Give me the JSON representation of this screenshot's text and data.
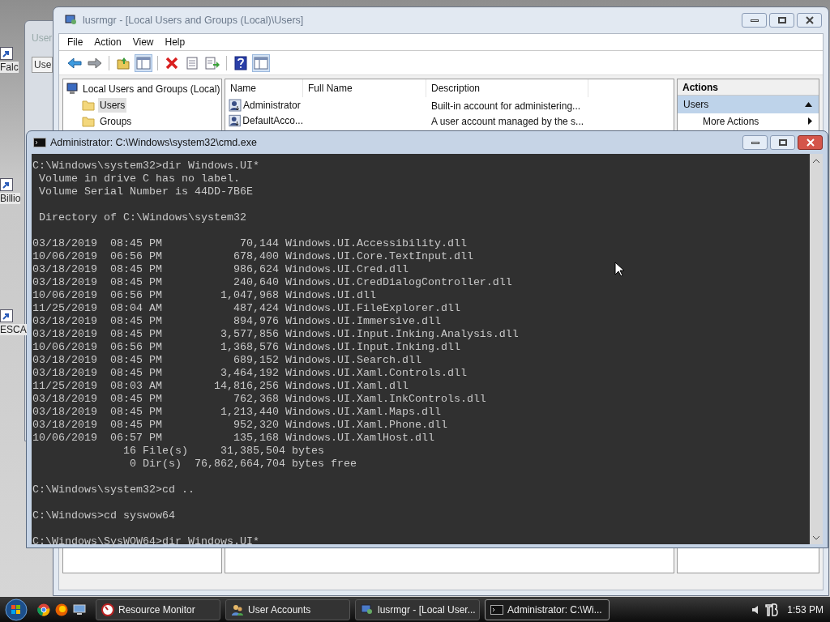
{
  "desktop_icons": [
    {
      "label": "Falc"
    },
    {
      "label": "Billio"
    },
    {
      "label": "ESCA"
    }
  ],
  "background_window": {
    "title": "User",
    "tab": "Use"
  },
  "mmc": {
    "title": "lusrmgr - [Local Users and Groups (Local)\\Users]",
    "menu": [
      "File",
      "Action",
      "View",
      "Help"
    ],
    "toolbar": [
      {
        "kind": "back",
        "pressed": false
      },
      {
        "kind": "forward",
        "pressed": false
      },
      {
        "kind": "up",
        "pressed": false
      },
      {
        "kind": "tree",
        "pressed": true
      },
      {
        "kind": "delete",
        "pressed": false
      },
      {
        "kind": "properties",
        "pressed": false
      },
      {
        "kind": "export",
        "pressed": false
      },
      {
        "kind": "help",
        "pressed": false
      },
      {
        "kind": "actionpane",
        "pressed": true
      }
    ],
    "tree": {
      "root": "Local Users and Groups (Local)",
      "children": [
        {
          "label": "Users",
          "selected": true
        },
        {
          "label": "Groups",
          "selected": false
        }
      ]
    },
    "columns": [
      "Name",
      "Full Name",
      "Description"
    ],
    "rows": [
      {
        "name": "Administrator",
        "description": "Built-in account for administering..."
      },
      {
        "name": "DefaultAcco...",
        "description": "A user account managed by the s..."
      }
    ],
    "actions": {
      "header": "Actions",
      "sections": [
        {
          "title": "Users",
          "selected": true,
          "items": [
            "More Actions"
          ]
        }
      ]
    }
  },
  "console": {
    "title": "Administrator: C:\\Windows\\system32\\cmd.exe",
    "lines": [
      {
        "kind": "text",
        "text": "C:\\Windows\\system32>dir Windows.UI*"
      },
      {
        "kind": "text",
        "text": " Volume in drive C has no label."
      },
      {
        "kind": "text",
        "text": " Volume Serial Number is 44DD-7B6E"
      },
      {
        "kind": "blank"
      },
      {
        "kind": "text",
        "text": " Directory of C:\\Windows\\system32"
      },
      {
        "kind": "blank"
      },
      {
        "kind": "text",
        "text": "03/18/2019  08:45 PM            70,144 Windows.UI.Accessibility.dll"
      },
      {
        "kind": "text",
        "text": "10/06/2019  06:56 PM           678,400 Windows.UI.Core.TextInput.dll"
      },
      {
        "kind": "text",
        "text": "03/18/2019  08:45 PM           986,624 Windows.UI.Cred.dll"
      },
      {
        "kind": "text",
        "text": "03/18/2019  08:45 PM           240,640 Windows.UI.CredDialogController.dll"
      },
      {
        "kind": "text",
        "text": "10/06/2019  06:56 PM         1,047,968 Windows.UI.dll"
      },
      {
        "kind": "text",
        "text": "11/25/2019  08:04 AM           487,424 Windows.UI.FileExplorer.dll"
      },
      {
        "kind": "text",
        "text": "03/18/2019  08:45 PM           894,976 Windows.UI.Immersive.dll"
      },
      {
        "kind": "text",
        "text": "03/18/2019  08:45 PM         3,577,856 Windows.UI.Input.Inking.Analysis.dll"
      },
      {
        "kind": "text",
        "text": "10/06/2019  06:56 PM         1,368,576 Windows.UI.Input.Inking.dll"
      },
      {
        "kind": "text",
        "text": "03/18/2019  08:45 PM           689,152 Windows.UI.Search.dll"
      },
      {
        "kind": "text",
        "text": "03/18/2019  08:45 PM         3,464,192 Windows.UI.Xaml.Controls.dll"
      },
      {
        "kind": "text",
        "text": "11/25/2019  08:03 AM        14,816,256 Windows.UI.Xaml.dll"
      },
      {
        "kind": "text",
        "text": "03/18/2019  08:45 PM           762,368 Windows.UI.Xaml.InkControls.dll"
      },
      {
        "kind": "text",
        "text": "03/18/2019  08:45 PM         1,213,440 Windows.UI.Xaml.Maps.dll"
      },
      {
        "kind": "text",
        "text": "03/18/2019  08:45 PM           952,320 Windows.UI.Xaml.Phone.dll"
      },
      {
        "kind": "text",
        "text": "10/06/2019  06:57 PM           135,168 Windows.UI.XamlHost.dll"
      },
      {
        "kind": "text",
        "text": "              16 File(s)     31,385,504 bytes"
      },
      {
        "kind": "text",
        "text": "               0 Dir(s)  76,862,664,704 bytes free"
      },
      {
        "kind": "blank"
      },
      {
        "kind": "text",
        "text": "C:\\Windows\\system32>cd .."
      },
      {
        "kind": "blank"
      },
      {
        "kind": "text",
        "text": "C:\\Windows>cd syswow64"
      },
      {
        "kind": "blank"
      },
      {
        "kind": "text",
        "text": "C:\\Windows\\SysWOW64>dir Windows.UI*"
      }
    ]
  },
  "taskbar": {
    "buttons": [
      {
        "label": "Resource Monitor",
        "kind": "monitor",
        "selected": false
      },
      {
        "label": "User Accounts",
        "kind": "users",
        "selected": false
      },
      {
        "label": "lusrmgr - [Local User...",
        "kind": "mmc",
        "selected": false
      },
      {
        "label": "Administrator: C:\\Wi...",
        "kind": "console",
        "selected": true
      }
    ],
    "clock": "1:53 PM"
  }
}
